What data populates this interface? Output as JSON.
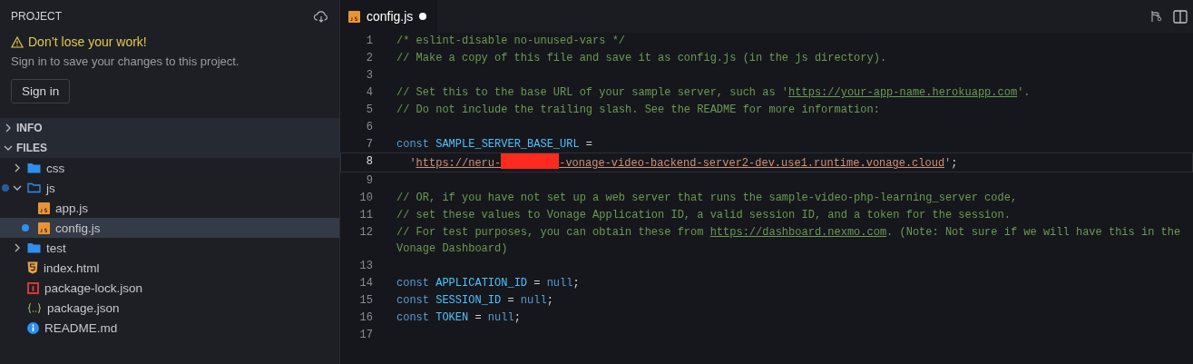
{
  "sidebar": {
    "title": "PROJECT",
    "notice": {
      "title": "Don’t lose your work!",
      "text": "Sign in to save your changes to this project.",
      "button": "Sign in"
    },
    "sections": [
      {
        "label": "INFO",
        "expanded": false
      },
      {
        "label": "FILES",
        "expanded": true
      }
    ],
    "files": [
      {
        "name": "css",
        "kind": "folder",
        "expanded": false,
        "selected": false,
        "modified": false
      },
      {
        "name": "js",
        "kind": "folder",
        "expanded": true,
        "selected": false,
        "modified": true,
        "children": [
          {
            "name": "app.js",
            "kind": "js",
            "selected": false,
            "modified": false
          },
          {
            "name": "config.js",
            "kind": "js",
            "selected": true,
            "modified": true
          }
        ]
      },
      {
        "name": "test",
        "kind": "folder",
        "expanded": false,
        "selected": false,
        "modified": false
      },
      {
        "name": "index.html",
        "kind": "html",
        "selected": false,
        "modified": false
      },
      {
        "name": "package-lock.json",
        "kind": "npm",
        "selected": false,
        "modified": false
      },
      {
        "name": "package.json",
        "kind": "json",
        "selected": false,
        "modified": false
      },
      {
        "name": "README.md",
        "kind": "info",
        "selected": false,
        "modified": false
      }
    ]
  },
  "editor": {
    "tabs": [
      {
        "label": "config.js",
        "kind": "js",
        "selected": true,
        "modified": true
      }
    ],
    "lines": [
      {
        "number": "1",
        "current": false,
        "tokens": [
          {
            "kind": "comment",
            "text": "/* eslint-disable no-unused-vars */"
          }
        ]
      },
      {
        "number": "2",
        "current": false,
        "tokens": [
          {
            "kind": "comment",
            "text": "// Make a copy of this file and save it as config.js (in the js directory)."
          }
        ]
      },
      {
        "number": "3",
        "current": false
      },
      {
        "number": "4",
        "current": false,
        "tokens": [
          {
            "kind": "comment",
            "text": "// Set this to the base URL of your sample server, such as '"
          },
          {
            "kind": "comment-link",
            "text": "https://your-app-name.herokuapp.com"
          },
          {
            "kind": "comment",
            "text": "'."
          }
        ]
      },
      {
        "number": "5",
        "current": false,
        "tokens": [
          {
            "kind": "comment",
            "text": "// Do not include the trailing slash. See the README for more information:"
          }
        ]
      },
      {
        "number": "6",
        "current": false
      },
      {
        "number": "7",
        "current": false,
        "tokens": [
          {
            "kind": "keyword",
            "text": "const "
          },
          {
            "kind": "ident",
            "text": "SAMPLE_SERVER_BASE_URL"
          },
          {
            "kind": "plain",
            "text": " ="
          }
        ]
      },
      {
        "number": "8",
        "current": true,
        "indent": true,
        "tokens": [
          {
            "kind": "string",
            "text": "'"
          },
          {
            "kind": "string-link",
            "text": "https://neru-"
          },
          {
            "kind": "redacted"
          },
          {
            "kind": "string-link",
            "text": "-vonage-video-backend-server2-dev.use1.runtime.vonage.cloud"
          },
          {
            "kind": "string",
            "text": "'"
          },
          {
            "kind": "plain",
            "text": ";"
          }
        ]
      },
      {
        "number": "9",
        "current": false
      },
      {
        "number": "10",
        "current": false,
        "tokens": [
          {
            "kind": "comment",
            "text": "// OR, if you have not set up a web server that runs the sample-video-php-learning_server code,"
          }
        ]
      },
      {
        "number": "11",
        "current": false,
        "tokens": [
          {
            "kind": "comment",
            "text": "// set these values to Vonage Application ID, a valid session ID, and a token for the session."
          }
        ]
      },
      {
        "number": "12",
        "current": false,
        "tokens": [
          {
            "kind": "comment",
            "text": "// For test purposes, you can obtain these from "
          },
          {
            "kind": "comment-link",
            "text": "https://dashboard.nexmo.com"
          },
          {
            "kind": "comment",
            "text": ". (Note: Not sure if we will have this in the Vonage Dashboard)"
          }
        ]
      },
      {
        "number": "13",
        "current": false
      },
      {
        "number": "14",
        "current": false,
        "tokens": [
          {
            "kind": "keyword",
            "text": "const "
          },
          {
            "kind": "ident",
            "text": "APPLICATION_ID"
          },
          {
            "kind": "plain",
            "text": " = "
          },
          {
            "kind": "keyword",
            "text": "null"
          },
          {
            "kind": "plain",
            "text": ";"
          }
        ]
      },
      {
        "number": "15",
        "current": false,
        "tokens": [
          {
            "kind": "keyword",
            "text": "const "
          },
          {
            "kind": "ident",
            "text": "SESSION_ID"
          },
          {
            "kind": "plain",
            "text": " = "
          },
          {
            "kind": "keyword",
            "text": "null"
          },
          {
            "kind": "plain",
            "text": ";"
          }
        ]
      },
      {
        "number": "16",
        "current": false,
        "tokens": [
          {
            "kind": "keyword",
            "text": "const "
          },
          {
            "kind": "ident",
            "text": "TOKEN"
          },
          {
            "kind": "plain",
            "text": " = "
          },
          {
            "kind": "keyword",
            "text": "null"
          },
          {
            "kind": "plain",
            "text": ";"
          }
        ]
      },
      {
        "number": "17",
        "current": false
      }
    ]
  }
}
